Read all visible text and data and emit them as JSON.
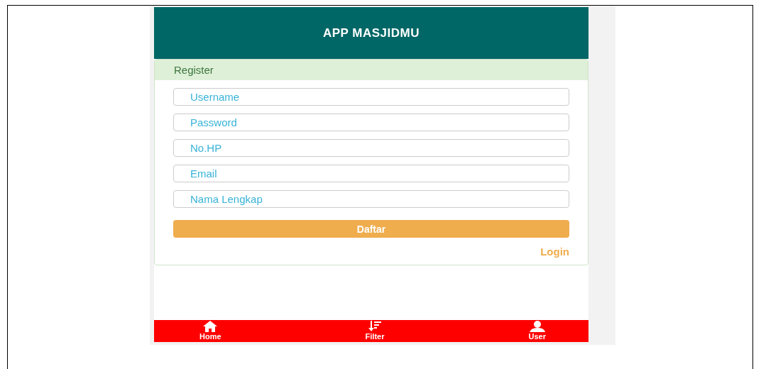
{
  "header": {
    "title": "APP MASJIDMU"
  },
  "panel": {
    "title": "Register",
    "fields": [
      {
        "placeholder": "Username"
      },
      {
        "placeholder": "Password"
      },
      {
        "placeholder": "No.HP"
      },
      {
        "placeholder": "Email"
      },
      {
        "placeholder": "Nama Lengkap"
      }
    ],
    "submit": "Daftar",
    "link": "Login"
  },
  "nav": [
    {
      "kind": "home",
      "label": "Home"
    },
    {
      "kind": "filter",
      "label": "Filter"
    },
    {
      "kind": "user",
      "label": "User"
    }
  ]
}
